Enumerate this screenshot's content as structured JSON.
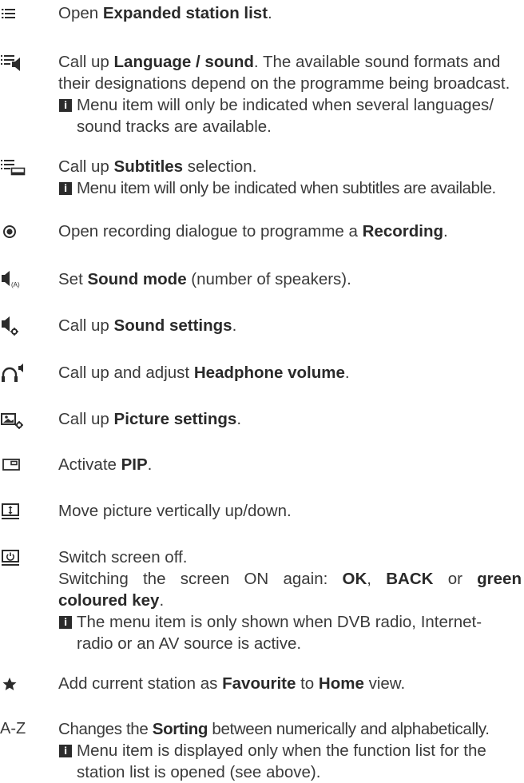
{
  "entries": [
    {
      "icon": "list-icon",
      "parts": [
        "Open ",
        "Expanded station list",
        "."
      ]
    },
    {
      "icon": "language-sound-icon",
      "parts": [
        "Call up ",
        "Language / sound",
        ". The available sound formats and"
      ],
      "line2": "their designations depend on the programme being broadcast.",
      "note1": "Menu item will only be indicated when several languages/",
      "note2": "sound tracks are available."
    },
    {
      "icon": "subtitles-icon",
      "parts": [
        "Call up ",
        "Subtitles",
        " selection."
      ],
      "note1": "Menu item will only be indicated when subtitles are available."
    },
    {
      "icon": "record-icon",
      "parts": [
        "Open recording dialogue to programme a ",
        "Recording",
        "."
      ]
    },
    {
      "icon": "sound-mode-icon",
      "parts": [
        "Set ",
        "Sound mode",
        " (number of speakers)."
      ]
    },
    {
      "icon": "sound-settings-icon",
      "parts": [
        "Call up ",
        "Sound settings",
        "."
      ]
    },
    {
      "icon": "headphone-volume-icon",
      "parts": [
        "Call up and adjust ",
        "Headphone volume",
        "."
      ]
    },
    {
      "icon": "picture-settings-icon",
      "parts": [
        "Call up ",
        "Picture settings",
        "."
      ]
    },
    {
      "icon": "pip-icon",
      "parts": [
        "Activate ",
        "PIP",
        "."
      ]
    },
    {
      "icon": "move-picture-icon",
      "parts": [
        "Move picture vertically up/down."
      ]
    },
    {
      "icon": "screen-off-icon",
      "line1": "Switch screen off.",
      "line2a": "Switching the screen ON again: ",
      "ok": "OK",
      "sep1": ", ",
      "back": "BACK",
      "sep2": " or ",
      "green1": "green",
      "green2": "coloured key",
      "end": ".",
      "note1": "The menu item is only shown when DVB radio, Internet-",
      "note2": "radio or an AV source is active."
    },
    {
      "icon": "star-icon",
      "parts": [
        "Add current station as ",
        "Favourite",
        " to ",
        "Home",
        " view."
      ]
    },
    {
      "icon": "az-sort-icon",
      "icon_text": "A-Z",
      "parts": [
        "Changes the ",
        "Sorting",
        " between numerically and alphabetically."
      ],
      "note1": "Menu item is displayed only when the function list for the",
      "note2": "station list is opened (see above)."
    }
  ],
  "info_glyph": "i"
}
